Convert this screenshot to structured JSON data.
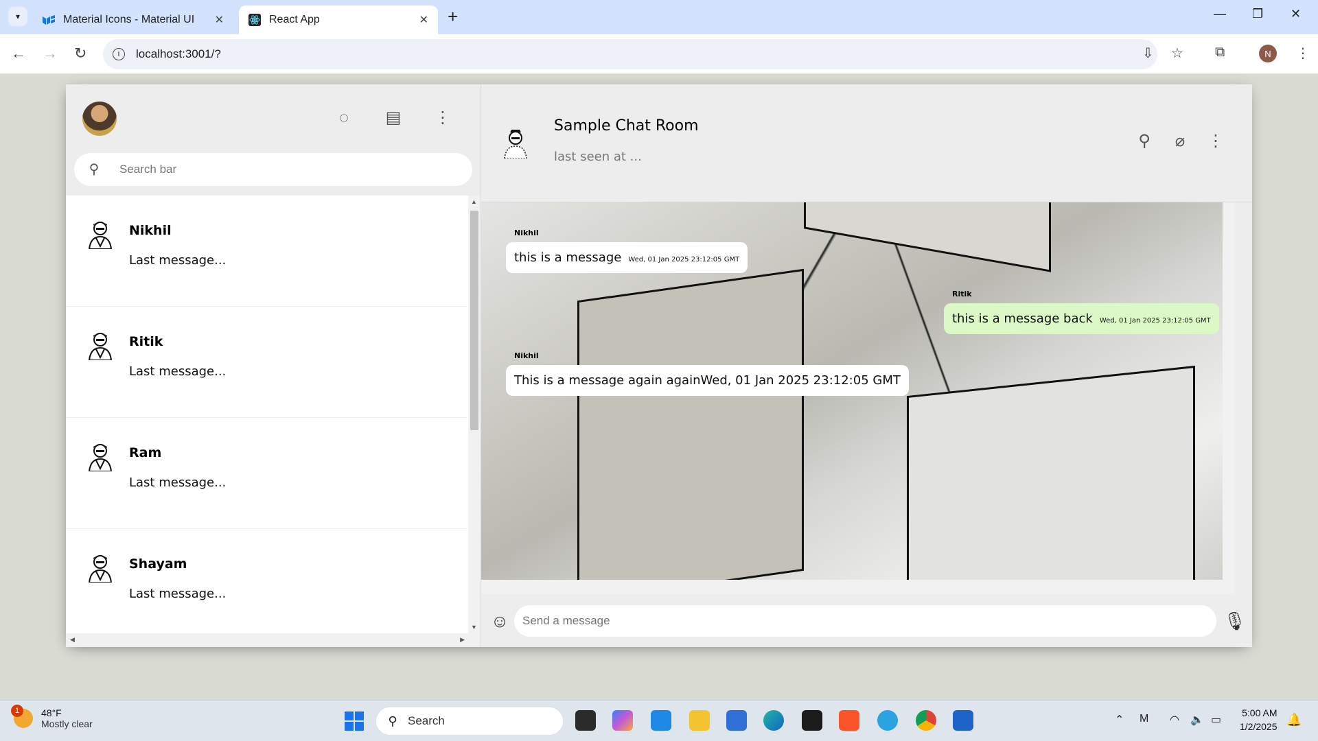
{
  "browser": {
    "tabs": [
      {
        "title": "Material Icons - Material UI",
        "active": false
      },
      {
        "title": "React App",
        "active": true
      }
    ],
    "url": "localhost:3001/?",
    "profile_initial": "N"
  },
  "sidebar": {
    "search_placeholder": "Search bar",
    "chats": [
      {
        "name": "Nikhil",
        "last_message": "Last message..."
      },
      {
        "name": "Ritik",
        "last_message": "Last message..."
      },
      {
        "name": "Ram",
        "last_message": "Last message..."
      },
      {
        "name": "Shayam",
        "last_message": "Last message..."
      }
    ]
  },
  "chat": {
    "room_name": "Sample Chat Room",
    "last_seen": "last seen at ...",
    "messages": [
      {
        "sender": "Nikhil",
        "text": "this is a message",
        "timestamp": "Wed, 01 Jan 2025 23:12:05 GMT",
        "received": false
      },
      {
        "sender": "Ritik",
        "text": "this is a message back",
        "timestamp": "Wed, 01 Jan 2025 23:12:05 GMT",
        "received": true
      },
      {
        "sender": "Nikhil",
        "text": "This is a message again again",
        "timestamp": "Wed, 01 Jan 2025 23:12:05 GMT",
        "received": false
      }
    ],
    "input_placeholder": "Send a message"
  },
  "taskbar": {
    "weather_temp": "48°F",
    "weather_desc": "Mostly clear",
    "weather_badge": "1",
    "search_label": "Search",
    "time": "5:00 AM",
    "date": "1/2/2025"
  }
}
